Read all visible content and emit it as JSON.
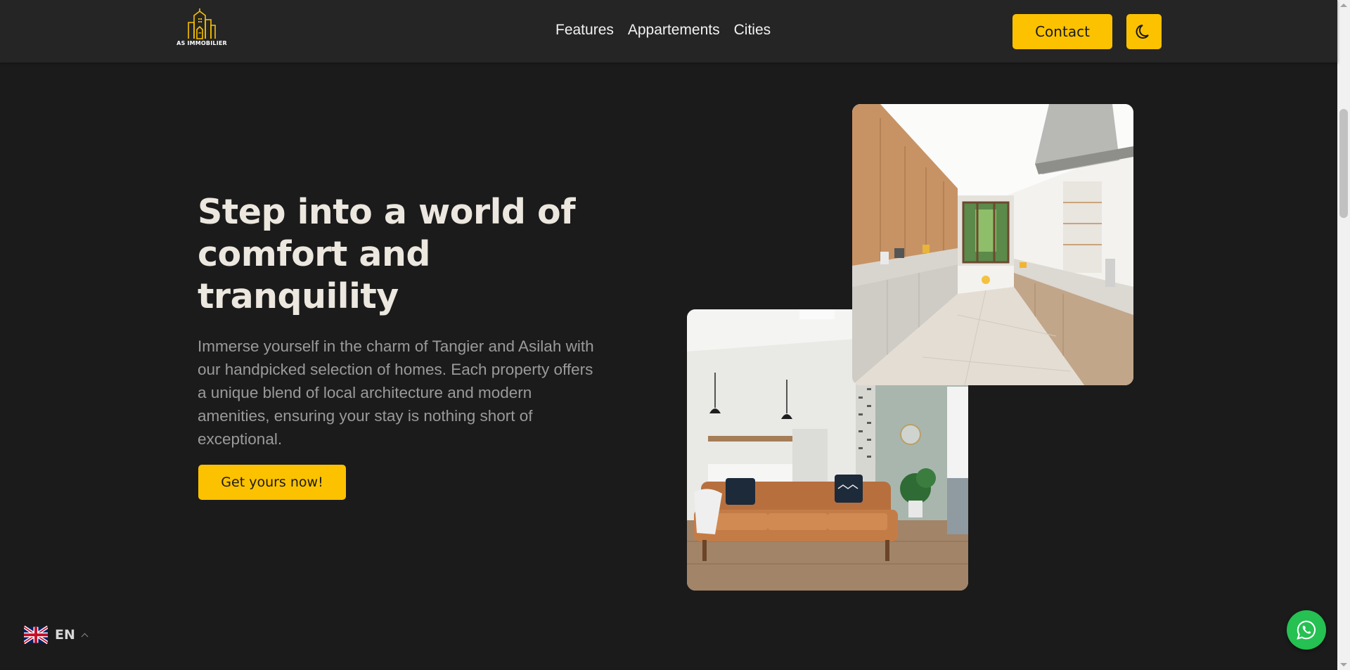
{
  "header": {
    "logo_text": "AS IMMOBILIER",
    "nav": [
      {
        "label": "Features"
      },
      {
        "label": "Appartements"
      },
      {
        "label": "Cities"
      }
    ],
    "contact_label": "Contact",
    "theme_icon": "moon-icon"
  },
  "hero": {
    "title": "Step into a world of comfort and tranquility",
    "description": "Immerse yourself in the charm of Tangier and Asilah with our handpicked selection of homes. Each property offers a unique blend of local architecture and modern amenities, ensuring your stay is nothing short of exceptional.",
    "cta_label": "Get yours now!"
  },
  "images": {
    "kitchen_icon": "kitchen-photo",
    "living_icon": "living-room-photo"
  },
  "language": {
    "code": "EN",
    "flag_icon": "uk-flag-icon"
  },
  "whatsapp_icon": "whatsapp-icon",
  "colors": {
    "accent": "#fcc200",
    "background": "#1b1b1b",
    "header_bg": "#252525",
    "whatsapp": "#25c152"
  }
}
